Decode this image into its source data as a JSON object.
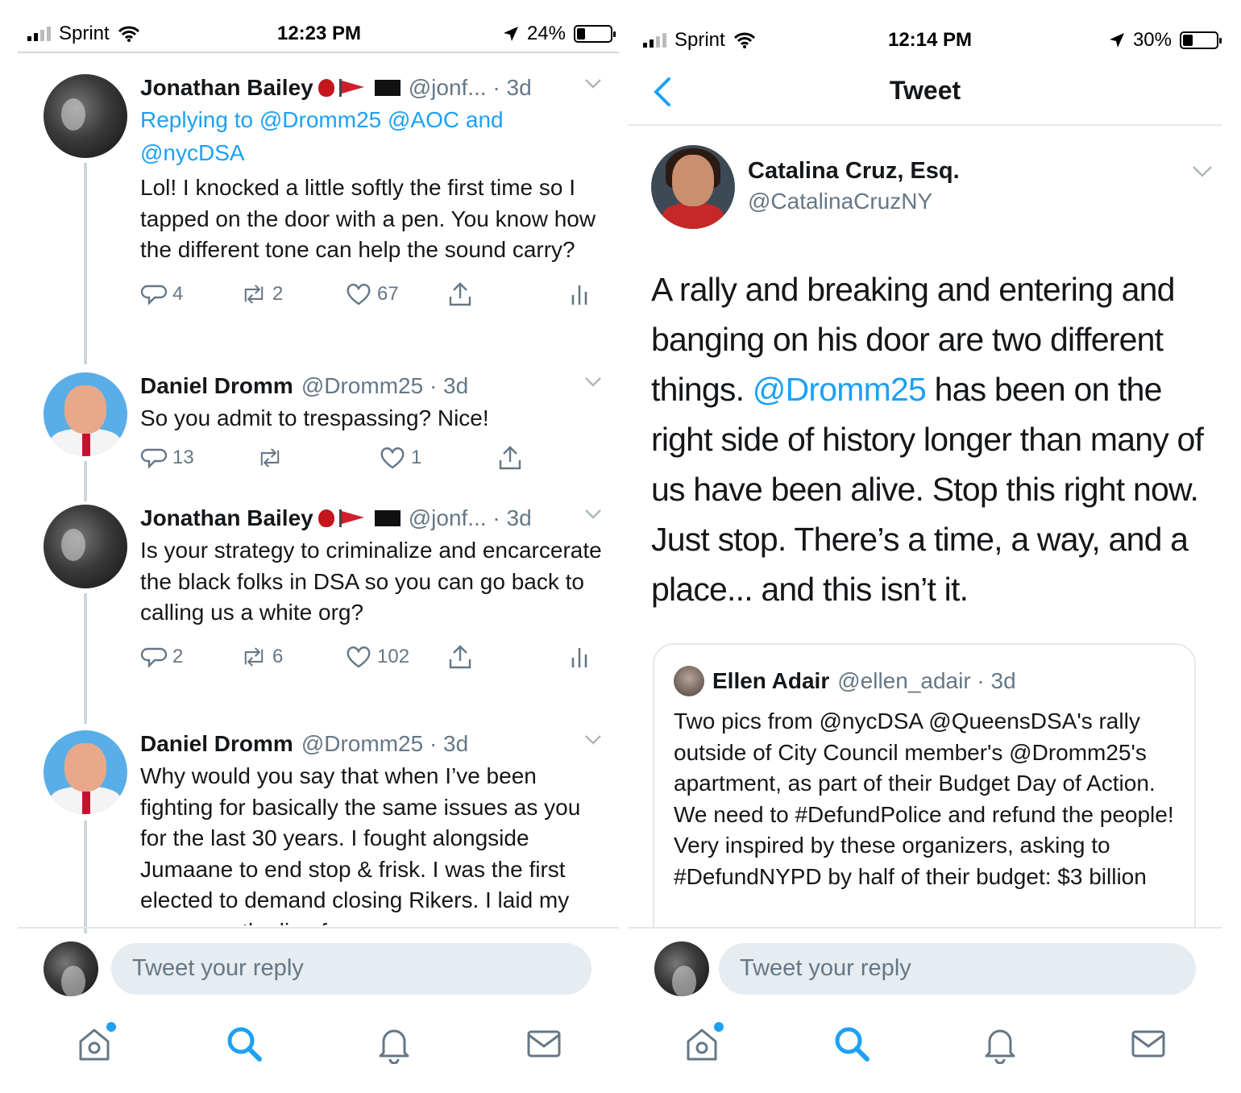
{
  "left": {
    "status": {
      "carrier": "Sprint",
      "time": "12:23 PM",
      "battery": "24%",
      "battery_level": 0.24
    },
    "tweets": [
      {
        "name": "Jonathan Bailey",
        "handle": "@jonf... · 3d",
        "reply_to_prefix": "Replying to ",
        "reply_to_users": "@Dromm25 @AOC",
        "reply_to_and": " and",
        "reply_to_last": "@nycDSA",
        "text": "Lol! I knocked a little softly the first time so I tapped on the door with a pen. You know how the different tone can help the sound carry?",
        "replies": "4",
        "retweets": "2",
        "likes": "67"
      },
      {
        "name": "Daniel Dromm",
        "handle": "@Dromm25 · 3d",
        "text": "So you admit to trespassing? Nice!",
        "replies": "13",
        "retweets": "",
        "likes": "1"
      },
      {
        "name": "Jonathan Bailey",
        "handle": "@jonf... · 3d",
        "text": "Is your strategy to criminalize and encarcerate the black folks in DSA so you can go back to calling us a white org?",
        "replies": "2",
        "retweets": "6",
        "likes": "102"
      },
      {
        "name": "Daniel Dromm",
        "handle": "@Dromm25 · 3d",
        "text": "Why would you say that when I’ve been fighting for basically the same issues as you for the last 30 years. I fought alongside Jumaane to end stop & frisk. I was the first elected to demand closing Rikers. I laid my career on the line for"
      }
    ],
    "composer": {
      "placeholder": "Tweet your reply"
    }
  },
  "right": {
    "status": {
      "carrier": "Sprint",
      "time": "12:14 PM",
      "battery": "30%",
      "battery_level": 0.3
    },
    "nav_title": "Tweet",
    "main": {
      "name": "Catalina Cruz, Esq.",
      "handle": "@CatalinaCruzNY",
      "text_before": "A rally and breaking and entering and banging on his door are two different things. ",
      "mention": "@Dromm25",
      "text_after": " has been on the right side of history longer than many of us have been alive. Stop this right now. Just stop. There’s a time, a way, and a place... and this isn’t it."
    },
    "quote": {
      "name": "Ellen Adair",
      "handle": "@ellen_adair · 3d",
      "text": "Two pics from @nycDSA @QueensDSA's rally outside of City Council member's @Dromm25's apartment, as part of their Budget Day of Action. We need to #DefundPolice and refund the people! Very inspired by these organizers, asking to #DefundNYPD by half of their budget: $3 billion"
    },
    "composer": {
      "placeholder": "Tweet your reply"
    }
  },
  "tabs": [
    "home-icon",
    "search-icon",
    "notifications-icon",
    "messages-icon"
  ],
  "colors": {
    "accent": "#1da1f2",
    "text": "#14171a",
    "muted": "#657786"
  }
}
